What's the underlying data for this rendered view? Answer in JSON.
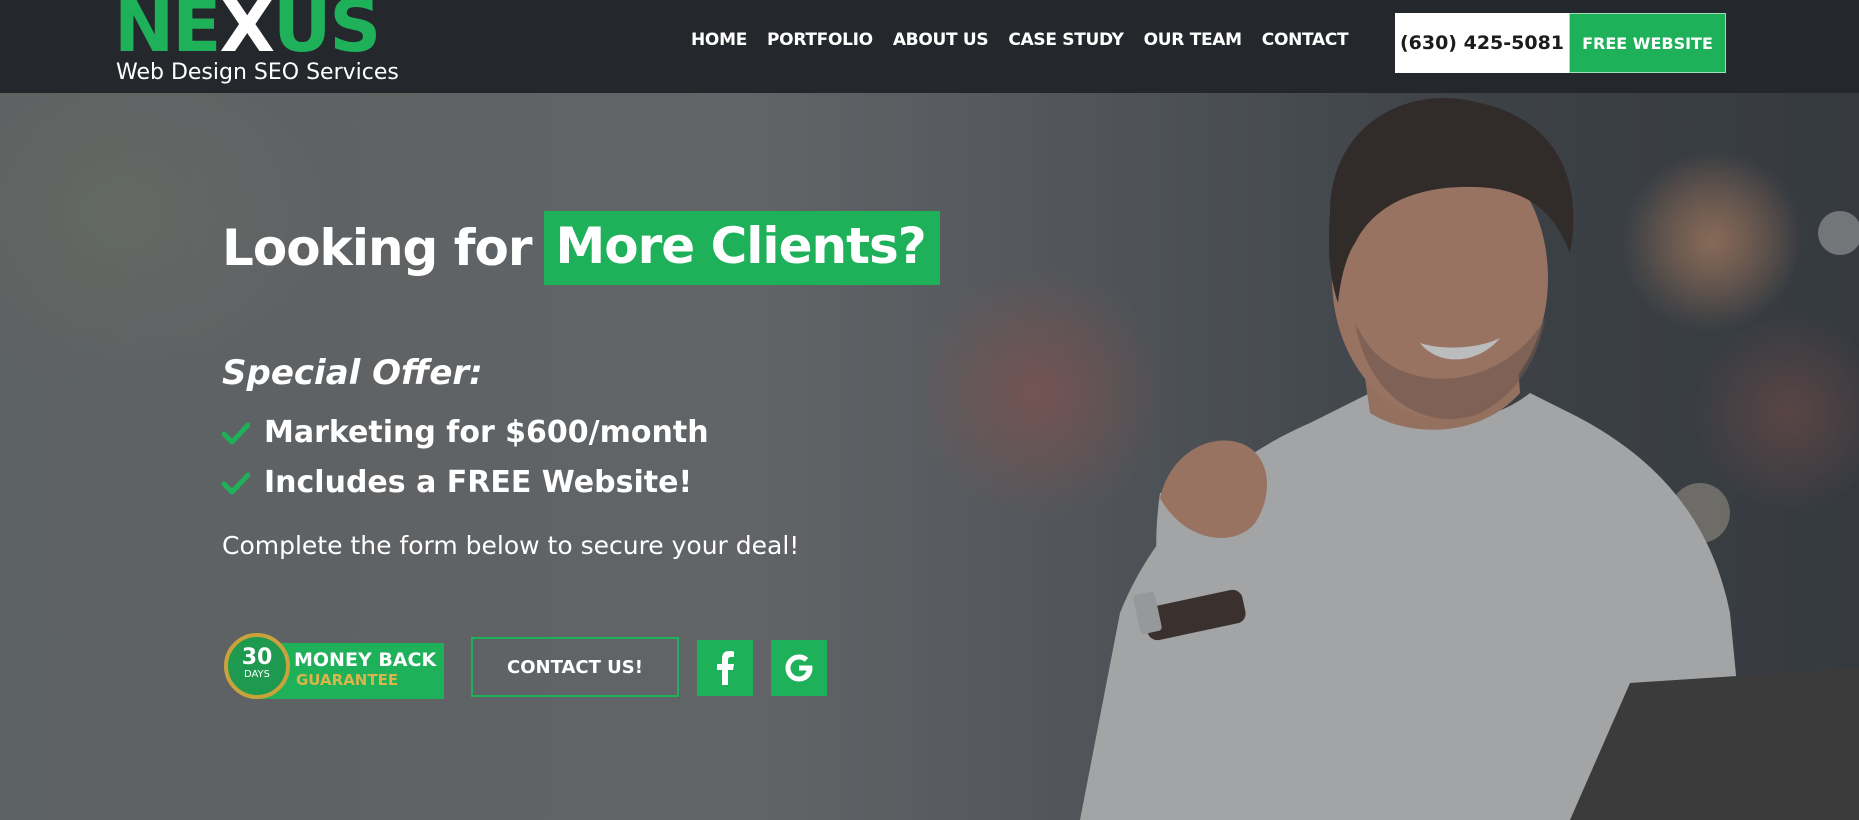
{
  "brand": {
    "logo_word": "NEXUS",
    "logo_left": "NE",
    "logo_x": "X",
    "logo_right": "US",
    "tagline": "Web Design SEO Services"
  },
  "nav": {
    "items": [
      "HOME",
      "PORTFOLIO",
      "ABOUT US",
      "CASE STUDY",
      "OUR TEAM",
      "CONTACT"
    ]
  },
  "header": {
    "phone": "(630) 425-5081",
    "cta_label": "FREE WEBSITE"
  },
  "hero": {
    "headline_plain": "Looking for",
    "headline_highlight": "More Clients?",
    "offer_title": "Special Offer:",
    "bullets": [
      "Marketing for $600/month",
      "Includes a FREE Website!"
    ],
    "subline": "Complete the form below to secure your deal!",
    "badge": {
      "days_number": "30",
      "days_label": "DAYS",
      "line1": "MONEY BACK",
      "line2": "GUARANTEE"
    },
    "contact_label": "CONTACT US!",
    "social_icons": [
      "facebook-icon",
      "google-icon"
    ]
  },
  "colors": {
    "accent": "#1fb05a",
    "header_bg": "#24272b",
    "gold": "#c9a23b"
  }
}
